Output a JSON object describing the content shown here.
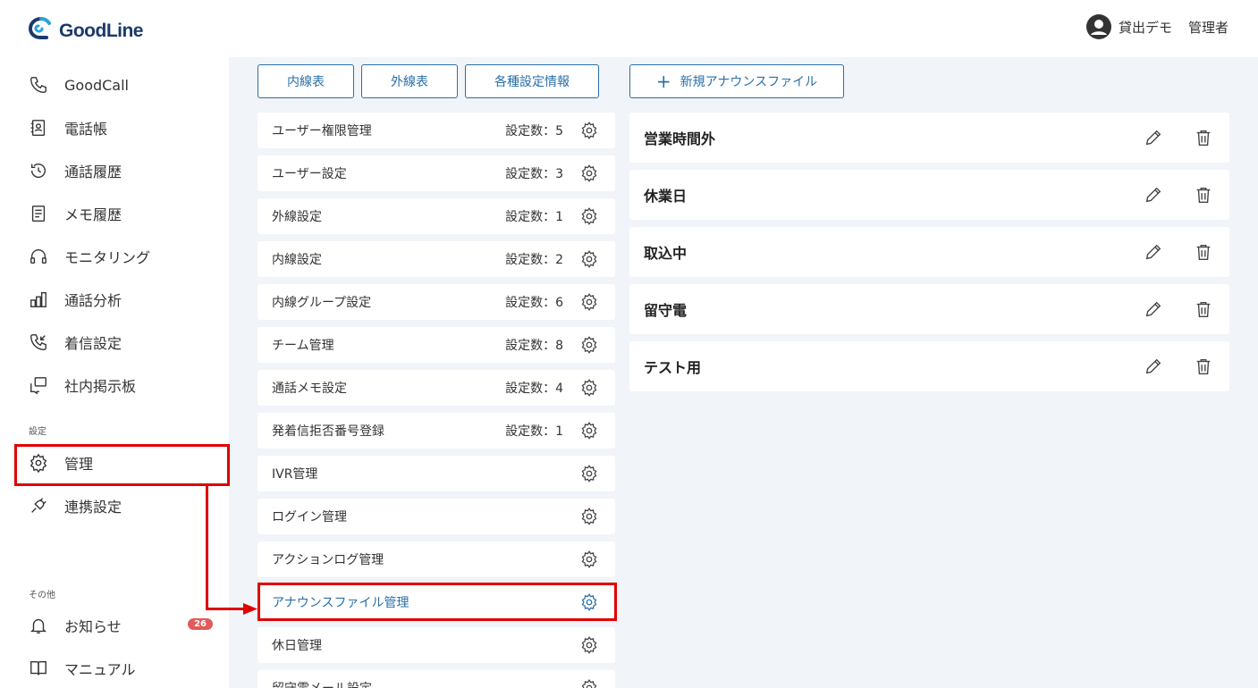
{
  "header": {
    "logo_text": "GoodLine",
    "user_name": "貸出デモ",
    "user_role": "管理者"
  },
  "sidebar": {
    "items": [
      {
        "label": "GoodCall",
        "icon": "phone-icon"
      },
      {
        "label": "電話帳",
        "icon": "contact-book-icon"
      },
      {
        "label": "通話履歴",
        "icon": "history-icon"
      },
      {
        "label": "メモ履歴",
        "icon": "memo-icon"
      },
      {
        "label": "モニタリング",
        "icon": "headset-icon"
      },
      {
        "label": "通話分析",
        "icon": "bar-chart-icon"
      },
      {
        "label": "着信設定",
        "icon": "incoming-call-icon"
      },
      {
        "label": "社内掲示板",
        "icon": "board-icon"
      }
    ],
    "section_settings": "設定",
    "settings_items": [
      {
        "label": "管理",
        "icon": "gear-icon"
      },
      {
        "label": "連携設定",
        "icon": "plug-icon"
      }
    ],
    "section_other": "その他",
    "other_items": [
      {
        "label": "お知らせ",
        "icon": "bell-icon",
        "badge": "26"
      },
      {
        "label": "マニュアル",
        "icon": "book-icon"
      }
    ]
  },
  "tabs": {
    "internal": "内線表",
    "external": "外線表",
    "settings_info": "各種設定情報",
    "new_announce": "新規アナウンスファイル"
  },
  "settings_list": [
    {
      "label": "ユーザー権限管理",
      "count": "設定数：5"
    },
    {
      "label": "ユーザー設定",
      "count": "設定数：3"
    },
    {
      "label": "外線設定",
      "count": "設定数：1"
    },
    {
      "label": "内線設定",
      "count": "設定数：2"
    },
    {
      "label": "内線グループ設定",
      "count": "設定数：6"
    },
    {
      "label": "チーム管理",
      "count": "設定数：8"
    },
    {
      "label": "通話メモ設定",
      "count": "設定数：4"
    },
    {
      "label": "発着信拒否番号登録",
      "count": "設定数：1"
    },
    {
      "label": "IVR管理",
      "count": ""
    },
    {
      "label": "ログイン管理",
      "count": ""
    },
    {
      "label": "アクションログ管理",
      "count": ""
    },
    {
      "label": "アナウンスファイル管理",
      "count": "",
      "active": true
    },
    {
      "label": "休日管理",
      "count": ""
    },
    {
      "label": "留守電メール設定",
      "count": ""
    }
  ],
  "announce_files": [
    {
      "title": "営業時間外"
    },
    {
      "title": "休業日"
    },
    {
      "title": "取込中"
    },
    {
      "title": "留守電"
    },
    {
      "title": "テスト用"
    }
  ],
  "colors": {
    "accent": "#2a6fa8",
    "highlight": "#e00000",
    "badge": "#e05b5b",
    "panel_bg": "#f1f4f8"
  }
}
